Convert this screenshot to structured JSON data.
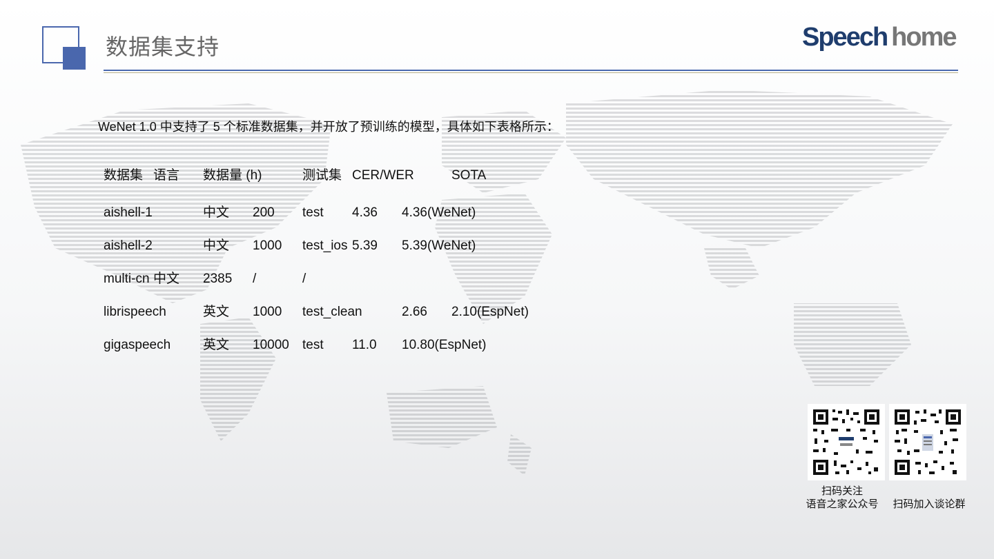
{
  "header": {
    "title": "数据集支持",
    "logo": {
      "part1": "Speech",
      "part2": "home"
    },
    "accent_color": "#4a67ad"
  },
  "intro": "WeNet 1.0  中支持了 5 个标准数据集，并开放了预训练的模型，具体如下表格所示：",
  "table": {
    "headers": [
      "数据集",
      "语言",
      "数据量 (h)",
      "测试集",
      "CER/WER",
      "SOTA"
    ],
    "rows": [
      [
        "aishell-1",
        "中文",
        "200",
        "test",
        "4.36",
        "4.36(WeNet)"
      ],
      [
        "aishell-2",
        "中文",
        "1000",
        "test_ios",
        "5.39",
        "5.39(WeNet)"
      ],
      [
        "multi-cn",
        "中文",
        "2385",
        "/",
        "/",
        ""
      ],
      [
        "librispeech",
        "英文",
        "1000",
        "test_clean",
        "2.66",
        "2.10(EspNet)"
      ],
      [
        "gigaspeech",
        "英文",
        "10000",
        "test",
        "11.0",
        "10.80(EspNet)"
      ]
    ]
  },
  "qr": [
    {
      "caption_line1": "扫码关注",
      "caption_line2": "语音之家公众号"
    },
    {
      "caption_line1": "",
      "caption_line2": "扫码加入谈论群"
    }
  ]
}
